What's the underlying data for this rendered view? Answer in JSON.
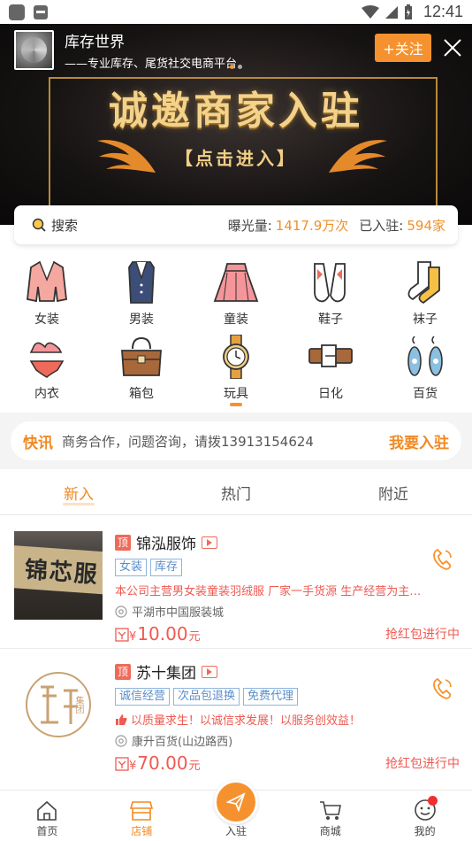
{
  "status_bar": {
    "time": "12:41"
  },
  "store": {
    "name": "库存世界",
    "slogan": "——专业库存、尾货社交电商平台",
    "follow_label": "+关注"
  },
  "banner": {
    "title": "诚邀商家入驻",
    "subtitle": "【点击进入】"
  },
  "search": {
    "label": "搜索",
    "exposure_label": "曝光量:",
    "exposure_value": "1417.9万次",
    "joined_label": "已入驻:",
    "joined_value": "594家"
  },
  "categories": [
    {
      "label": "女装",
      "icon": "womens-clothing-icon"
    },
    {
      "label": "男装",
      "icon": "mens-clothing-icon"
    },
    {
      "label": "童装",
      "icon": "kids-clothing-icon"
    },
    {
      "label": "鞋子",
      "icon": "shoes-icon"
    },
    {
      "label": "袜子",
      "icon": "socks-icon"
    },
    {
      "label": "内衣",
      "icon": "underwear-icon"
    },
    {
      "label": "箱包",
      "icon": "bag-icon"
    },
    {
      "label": "玩具",
      "icon": "toy-icon"
    },
    {
      "label": "日化",
      "icon": "belt-icon"
    },
    {
      "label": "百货",
      "icon": "earrings-icon"
    }
  ],
  "news": {
    "tag": "快讯",
    "message": "商务合作，问题咨询，请拨13913154624",
    "join_label": "我要入驻"
  },
  "tabs": [
    {
      "label": "新入",
      "active": true
    },
    {
      "label": "热门",
      "active": false
    },
    {
      "label": "附近",
      "active": false
    }
  ],
  "listings": [
    {
      "badge": "顶",
      "name": "锦泓服饰",
      "tags": [
        "女装",
        "库存"
      ],
      "description": "本公司主营男女装童装羽绒服 厂家一手货源 生产经营为主…",
      "location": "平湖市中国服装城",
      "price_currency": "¥",
      "price_value": "10.00",
      "price_unit": "元",
      "red_packet": "抢红包进行中",
      "thumb_text": "锦芯服"
    },
    {
      "badge": "顶",
      "name": "苏十集团",
      "tags": [
        "诚信经营",
        "次品包退换",
        "免费代理"
      ],
      "description": "以质量求生！以诚信求发展！以服务创效益！",
      "location": "康升百货(山边路西)",
      "price_currency": "¥",
      "price_value": "70.00",
      "price_unit": "元",
      "red_packet": "抢红包进行中",
      "thumb_text": "集团"
    }
  ],
  "bottom_nav": [
    {
      "label": "首页",
      "icon": "home-icon",
      "active": false
    },
    {
      "label": "店铺",
      "icon": "store-icon",
      "active": true
    },
    {
      "label": "入驻",
      "icon": "send-icon",
      "active": false
    },
    {
      "label": "商城",
      "icon": "cart-icon",
      "active": false
    },
    {
      "label": "我的",
      "icon": "profile-icon",
      "active": false
    }
  ],
  "colors": {
    "accent": "#f5922f",
    "accent_text": "#f08a22",
    "red": "#ef5a52",
    "tag_blue": "#5b8ec8"
  }
}
